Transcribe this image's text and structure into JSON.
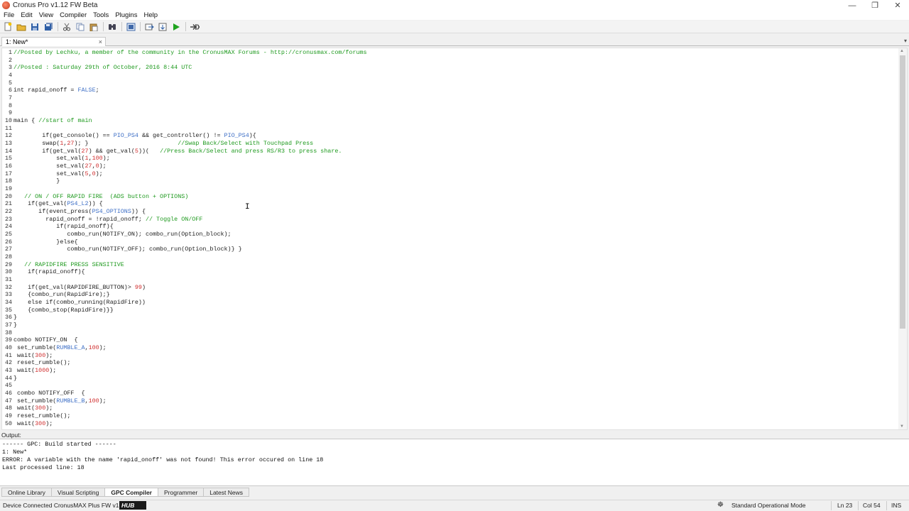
{
  "window": {
    "title": "Cronus Pro v1.12 FW Beta",
    "minimize": "—",
    "maximize": "❐",
    "close": "✕"
  },
  "menu": [
    "File",
    "Edit",
    "View",
    "Compiler",
    "Tools",
    "Plugins",
    "Help"
  ],
  "toolbar_icons": [
    "new-file-icon",
    "open-folder-icon",
    "save-icon",
    "save-all-icon",
    "cut-icon",
    "copy-icon",
    "paste-icon",
    "find-icon",
    "build-icon",
    "program-icon",
    "import-icon",
    "run-icon",
    "forward-icon"
  ],
  "tab": {
    "label": "1: New*",
    "close": "×",
    "dropdown": "▾"
  },
  "code_lines": [
    [
      [
        "cm",
        "//Posted by Lechku, a member of the community in the CronusMAX Forums - http://cronusmax.com/forums"
      ]
    ],
    [],
    [
      [
        "cm",
        "//Posted : Saturday 29th of October, 2016 8:44 UTC"
      ]
    ],
    [],
    [],
    [
      [
        "kw",
        "int"
      ],
      [
        "fn",
        " rapid_onoff = "
      ],
      [
        "cn",
        "FALSE"
      ],
      [
        "fn",
        ";"
      ]
    ],
    [],
    [],
    [],
    [
      [
        "kw",
        "main"
      ],
      [
        "fn",
        " { "
      ],
      [
        "cm",
        "//start of main"
      ]
    ],
    [],
    [
      [
        "fn",
        "        if(get_console() == "
      ],
      [
        "cn",
        "PIO_PS4"
      ],
      [
        "fn",
        " && get_controller() != "
      ],
      [
        "cn",
        "PIO_PS4"
      ],
      [
        "fn",
        "){"
      ]
    ],
    [
      [
        "fn",
        "        swap("
      ],
      [
        "nm",
        "1"
      ],
      [
        "fn",
        ","
      ],
      [
        "nm",
        "27"
      ],
      [
        "fn",
        "); }                         "
      ],
      [
        "cm",
        "//Swap Back/Select with Touchpad Press"
      ]
    ],
    [
      [
        "fn",
        "        if(get_val("
      ],
      [
        "nm",
        "27"
      ],
      [
        "fn",
        ") && get_val("
      ],
      [
        "nm",
        "5"
      ],
      [
        "fn",
        "))(   "
      ],
      [
        "cm",
        "//Press Back/Select and press RS/R3 to press share."
      ]
    ],
    [
      [
        "fn",
        "            set_val("
      ],
      [
        "nm",
        "1"
      ],
      [
        "fn",
        ","
      ],
      [
        "nm",
        "100"
      ],
      [
        "fn",
        ");"
      ]
    ],
    [
      [
        "fn",
        "            set_val("
      ],
      [
        "nm",
        "27"
      ],
      [
        "fn",
        ","
      ],
      [
        "nm",
        "0"
      ],
      [
        "fn",
        ");"
      ]
    ],
    [
      [
        "fn",
        "            set_val("
      ],
      [
        "nm",
        "5"
      ],
      [
        "fn",
        ","
      ],
      [
        "nm",
        "0"
      ],
      [
        "fn",
        ");"
      ]
    ],
    [
      [
        "fn",
        "            }"
      ]
    ],
    [],
    [
      [
        "cm",
        "   // ON / OFF RAPID FIRE  (ADS button + OPTIONS)"
      ]
    ],
    [
      [
        "fn",
        "    if(get_val("
      ],
      [
        "cn",
        "PS4_L2"
      ],
      [
        "fn",
        ")) {"
      ]
    ],
    [
      [
        "fn",
        "       if(event_press("
      ],
      [
        "cn",
        "PS4_OPTIONS"
      ],
      [
        "fn",
        ")) {"
      ]
    ],
    [
      [
        "fn",
        "         rapid_onoff = !rapid_onoff; "
      ],
      [
        "cm",
        "// Toggle ON/OFF"
      ]
    ],
    [
      [
        "fn",
        "            if(rapid_onoff){"
      ]
    ],
    [
      [
        "fn",
        "               combo_run(NOTIFY_ON); combo_run(Option_block);"
      ]
    ],
    [
      [
        "fn",
        "            }else{"
      ]
    ],
    [
      [
        "fn",
        "               combo_run(NOTIFY_OFF); combo_run(Option_block)} }"
      ]
    ],
    [],
    [
      [
        "cm",
        "   // RAPIDFIRE PRESS SENSITIVE"
      ]
    ],
    [
      [
        "fn",
        "    if(rapid_onoff){"
      ]
    ],
    [],
    [
      [
        "fn",
        "    if(get_val(RAPIDFIRE_BUTTON)> "
      ],
      [
        "nm",
        "99"
      ],
      [
        "fn",
        ")"
      ]
    ],
    [
      [
        "fn",
        "    {combo_run(RapidFire);}"
      ]
    ],
    [
      [
        "fn",
        "    else if(combo_running(RapidFire))"
      ]
    ],
    [
      [
        "fn",
        "    {combo_stop(RapidFire)}}"
      ]
    ],
    [
      [
        "fn",
        "}"
      ]
    ],
    [
      [
        "fn",
        "}"
      ]
    ],
    [],
    [
      [
        "kw",
        "combo"
      ],
      [
        "fn",
        " NOTIFY_ON  {"
      ]
    ],
    [
      [
        "fn",
        " set_rumble("
      ],
      [
        "cn",
        "RUMBLE_A"
      ],
      [
        "fn",
        ","
      ],
      [
        "nm",
        "100"
      ],
      [
        "fn",
        ");"
      ]
    ],
    [
      [
        "fn",
        " wait("
      ],
      [
        "nm",
        "300"
      ],
      [
        "fn",
        ");"
      ]
    ],
    [
      [
        "fn",
        " reset_rumble();"
      ]
    ],
    [
      [
        "fn",
        " wait("
      ],
      [
        "nm",
        "1000"
      ],
      [
        "fn",
        ");"
      ]
    ],
    [
      [
        "fn",
        "}"
      ]
    ],
    [],
    [
      [
        "kw",
        " combo"
      ],
      [
        "fn",
        " NOTIFY_OFF  {"
      ]
    ],
    [
      [
        "fn",
        " set_rumble("
      ],
      [
        "cn",
        "RUMBLE_B"
      ],
      [
        "fn",
        ","
      ],
      [
        "nm",
        "100"
      ],
      [
        "fn",
        ");"
      ]
    ],
    [
      [
        "fn",
        " wait("
      ],
      [
        "nm",
        "300"
      ],
      [
        "fn",
        ");"
      ]
    ],
    [
      [
        "fn",
        " reset_rumble();"
      ]
    ],
    [
      [
        "fn",
        " wait("
      ],
      [
        "nm",
        "300"
      ],
      [
        "fn",
        ");"
      ]
    ]
  ],
  "output": {
    "label": "Output:",
    "lines": [
      "------ GPC: Build started ------",
      "1: New*",
      "ERROR: A variable with the name 'rapid_onoff' was not found! This error occured on line 18",
      "Last processed line: 18"
    ]
  },
  "bottom_tabs": [
    {
      "label": "Online Library",
      "active": false
    },
    {
      "label": "Visual Scripting",
      "active": false
    },
    {
      "label": "GPC Compiler",
      "active": true
    },
    {
      "label": "Programmer",
      "active": false
    },
    {
      "label": "Latest News",
      "active": false
    }
  ],
  "status": {
    "device": "Device Connected CronusMAX Plus FW v1.23",
    "hub_logo": "HUB",
    "mode": "Standard Operational Mode",
    "line": "Ln 23",
    "col": "Col 54",
    "ins": "INS"
  }
}
